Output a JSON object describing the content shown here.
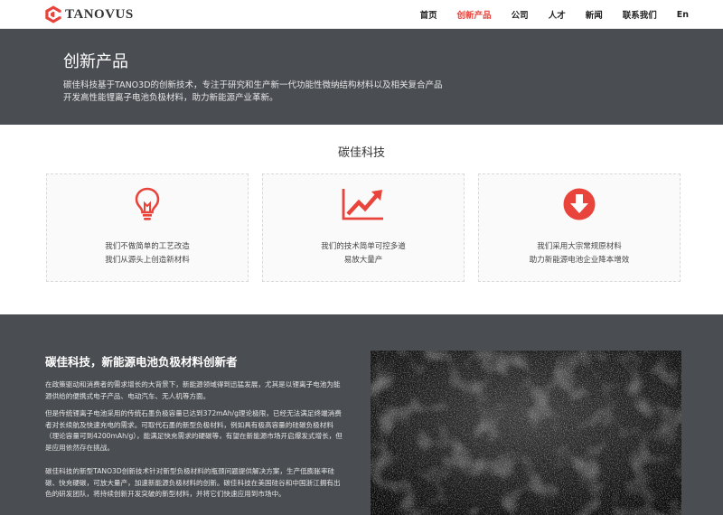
{
  "brand": {
    "name": "TANOVUS",
    "accent": "#e8443c",
    "logo_icon": "hexagon-c-logo-icon"
  },
  "nav": {
    "items": [
      {
        "label": "首页",
        "active": false
      },
      {
        "label": "创新产品",
        "active": true
      },
      {
        "label": "公司",
        "active": false
      },
      {
        "label": "人才",
        "active": false
      },
      {
        "label": "新闻",
        "active": false
      },
      {
        "label": "联系我们",
        "active": false
      },
      {
        "label": "En",
        "active": false
      }
    ]
  },
  "hero": {
    "title": "创新产品",
    "desc_line1": "碳佳科技基于TANO3D的创新技术，专注于研究和生产新一代功能性微纳结构材料以及相关复合产品",
    "desc_line2": "开发高性能锂离子电池负极材料，助力新能源产业革新。",
    "bg": "#4a4d52"
  },
  "section": {
    "title": "碳佳科技"
  },
  "cards": [
    {
      "icon": "lightbulb-icon",
      "line1": "我们不做简单的工艺改造",
      "line2": "我们从源头上创造新材料"
    },
    {
      "icon": "trend-up-chart-icon",
      "line1": "我们的技术简单可控多道",
      "line2": "易放大量产"
    },
    {
      "icon": "download-circle-icon",
      "line1": "我们采用大宗常规原材料",
      "line2": "助力新能源电池企业降本增效"
    }
  ],
  "bottom": {
    "title": "碳佳科技，新能源电池负极材料创新者",
    "p1": "在政策驱动和消费者的需求增长的大背景下，新能源领域得到迅猛发展，尤其是以锂离子电池为能源供给的便携式电子产品、电动汽车、无人机等方面。",
    "p2": "但是传统锂离子电池采用的传统石墨负极容量已达到372mAh/g理论极限，已经无法满足终端消费者对长续航及快速充电的需求。可取代石墨的新型负极材料，例如具有极高容量的硅碳负极材料（理论容量可到4200mAh/g），能满足快充需求的硬碳等，有望在新能源市场开启爆发式增长，但是应用依然存在挑战。",
    "p3": "碳佳科技的新型TANO3D创新技术针对新型负极材料的瓶颈问题提供解决方案，生产低膨胀率硅碳、快充硬碳，可放大量产，加速新能源负极材料的创新。碳佳科技在美国硅谷和中国浙江拥有出色的研发团队，将持续创新开发突破的新型材料，并将它们快速应用到市场中。",
    "photo": "dark-carbon-material-photo"
  }
}
